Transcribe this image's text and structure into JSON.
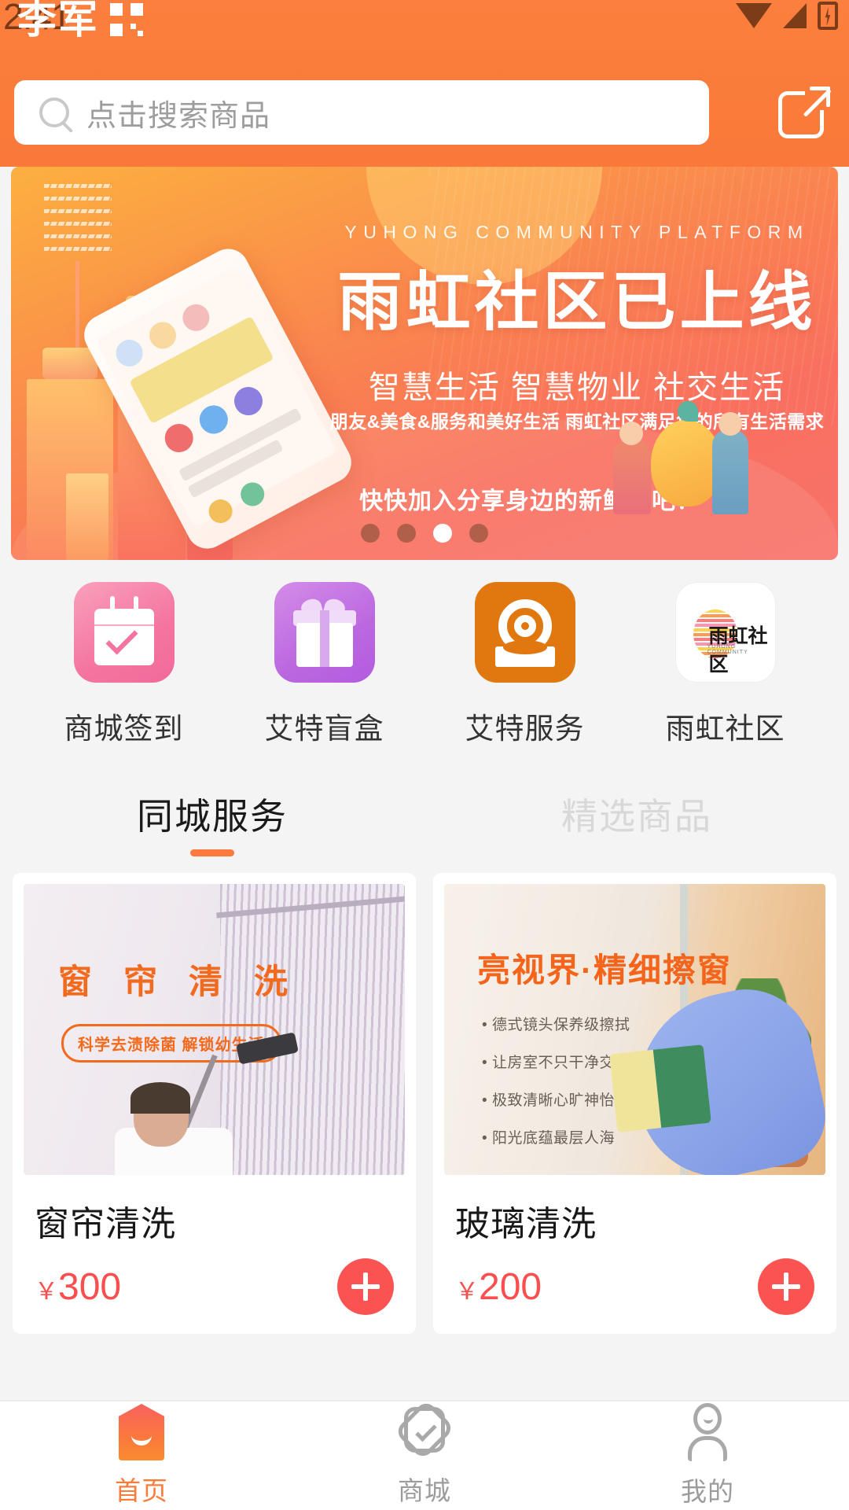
{
  "status_bar": {
    "time": "2:41",
    "watermark": "李军",
    "icons": [
      "qr-icon",
      "wifi-icon",
      "signal-icon",
      "battery-charging-icon"
    ]
  },
  "search": {
    "placeholder": "点击搜索商品",
    "icon": "search-icon",
    "share_icon": "share-external-icon"
  },
  "banner": {
    "eyebrow": "YUHONG COMMUNITY PLATFORM",
    "title": "雨虹社区已上线",
    "subtitle": "智慧生活   智慧物业   社交生活",
    "description": "朋友&美食&服务和美好生活  雨虹社区满足您的所有生活需求",
    "cta": "快快加入分享身边的新鲜事吧！",
    "dots_count": 4,
    "active_dot": 3
  },
  "categories": [
    {
      "label": "商城签到",
      "icon": "calendar-check-icon",
      "color": "#f2749f"
    },
    {
      "label": "艾特盲盒",
      "icon": "gift-box-icon",
      "color": "#b45ae0"
    },
    {
      "label": "艾特服务",
      "icon": "at-sign-icon",
      "color": "#e1770f"
    },
    {
      "label": "雨虹社区",
      "icon": "yuhong-logo-icon",
      "color": "#ffffff"
    }
  ],
  "tabs": [
    {
      "label": "同城服务",
      "active": true
    },
    {
      "label": "精选商品",
      "active": false
    }
  ],
  "products": [
    {
      "title": "窗帘清洗",
      "price": "300",
      "currency": "￥",
      "add_icon": "plus-icon",
      "image_title": "窗 帘 清 洗",
      "image_badge": "科学去渍除菌 解锁幼生活"
    },
    {
      "title": "玻璃清洗",
      "price": "200",
      "currency": "￥",
      "add_icon": "plus-icon",
      "image_title": "亮视界·精细擦窗",
      "image_bullets": [
        "德式镜头保养级擦拭",
        "让房室不只干净交济净",
        "极致清晰心旷神怡",
        "阳光底蕴最层人海"
      ]
    }
  ],
  "bottom_nav": [
    {
      "label": "首页",
      "icon": "home-icon",
      "active": true
    },
    {
      "label": "商城",
      "icon": "badge-check-icon",
      "active": false
    },
    {
      "label": "我的",
      "icon": "user-icon",
      "active": false
    }
  ],
  "colors": {
    "brand_orange": "#fa7c3a",
    "price_red": "#fb4e4e",
    "add_button": "#fb5252",
    "tab_underline": "#fc7a3e"
  }
}
